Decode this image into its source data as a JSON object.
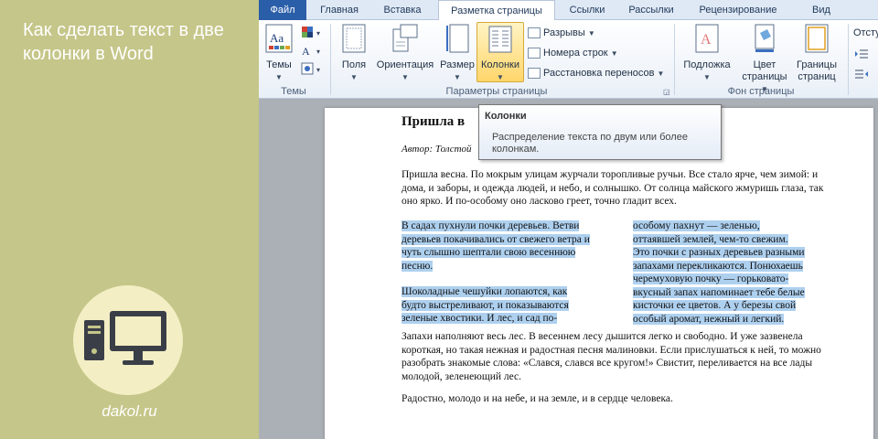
{
  "promo": {
    "title": "Как сделать текст в две колонки в Word",
    "site": "dakol.ru"
  },
  "tabs": [
    "Файл",
    "Главная",
    "Вставка",
    "Разметка страницы",
    "Ссылки",
    "Рассылки",
    "Рецензирование",
    "Вид"
  ],
  "ribbon": {
    "themes_label": "Темы",
    "fields_label": "Поля",
    "orientation_label": "Ориентация",
    "size_label": "Размер",
    "columns_label": "Колонки",
    "breaks_label": "Разрывы",
    "line_numbers_label": "Номера строк",
    "hyphenation_label": "Расстановка переносов",
    "watermark_label": "Подложка",
    "page_color_label_1": "Цвет",
    "page_color_label_2": "страницы",
    "page_borders_label_1": "Границы",
    "page_borders_label_2": "страниц",
    "indent_label": "Отсту",
    "group_themes": "Темы",
    "group_page_setup": "Параметры страницы",
    "group_page_background": "Фон страницы"
  },
  "tooltip": {
    "title": "Колонки",
    "description": "Распределение текста по двум или более колонкам."
  },
  "document": {
    "title": "Пришла в",
    "author": "Автор: Толстой",
    "intro": "Пришла весна. По мокрым улицам журчали торопливые ручьи. Все стало ярче, чем зимой: и дома, и заборы, и одежда людей, и небо, и солнышко. От солнца майского жмуришь глаза, так оно ярко. И по-особому оно ласково греет, точно гладит всех.",
    "col1_p1": "В садах пухнули почки деревьев. Ветви деревьев покачивались от свежего ветра и чуть слышно шептали свою весеннюю песню.",
    "col1_p2": "Шоколадные чешуйки лопаются, как будто выстреливают, и показываются зеленые хвостики. И лес, и сад по-",
    "col2_p1": "особому пахнут — зеленью, оттаявшей землей, чем-то свежим. Это почки с разных деревьев разными запахами переклика­ются. Понюхаешь черемуховую почку — горьковато-вкусный запах напоминает тебе белые кисточки ее цветов. А у березы свой особый аромат, нежный и легкий.",
    "after": "Запахи наполняют весь лес. В весеннем лесу дышится легко и свободно. И уже зазвенела короткая, но такая нежная и радостная песня малиновки. Если прислушаться к ней, то можно разобрать знакомые слова: «Слався, слався все кругом!» Свистит, переливается на все лады молодой, зеленеющий лес.",
    "last": "Радостно, молодо и на небе, и на земле, и в сердце человека."
  },
  "colors": {
    "promo_bg": "#c5c689",
    "file_tab": "#2b5ea8",
    "selection": "#aed0ef",
    "window_bg": "#abb0b6"
  }
}
